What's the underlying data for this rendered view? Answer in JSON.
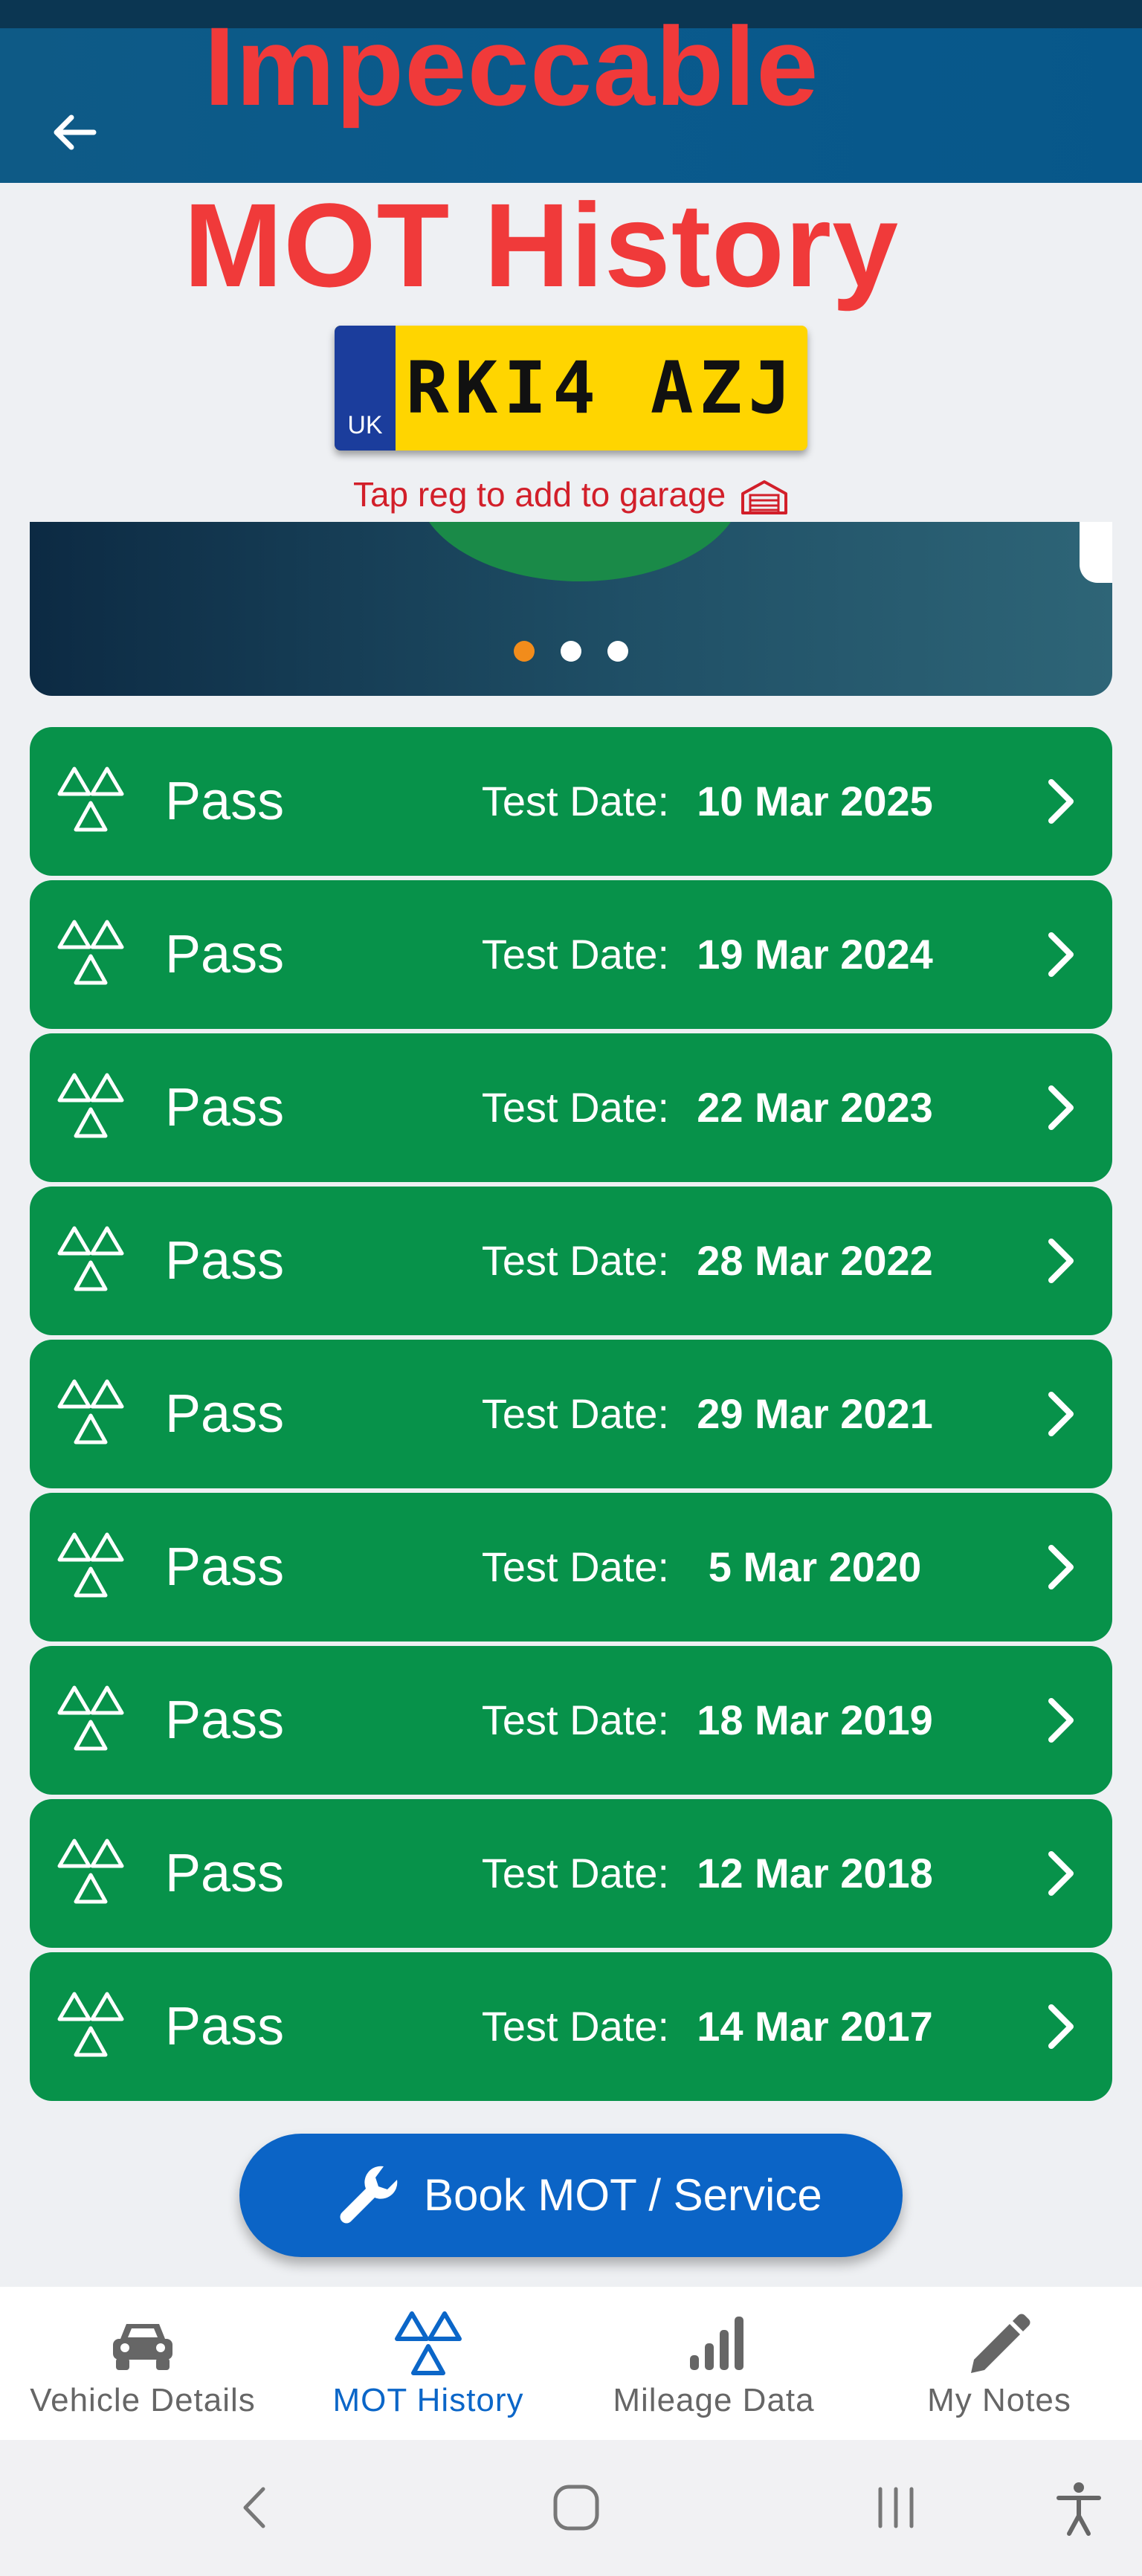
{
  "header": {
    "overlay_line1": "Impeccable",
    "overlay_line2": "MOT History",
    "back_icon": "arrow-left-icon",
    "bar_color": "#0a5a8c",
    "overlay_color": "#f03a3a"
  },
  "plate": {
    "country": "UK",
    "registration": "RKI4 AZJ"
  },
  "tap_hint": {
    "text": "Tap reg to add to garage",
    "icon": "garage-icon"
  },
  "carousel": {
    "dot_count": 3,
    "active_index": 0
  },
  "mot_tests": [
    {
      "result": "Pass",
      "label": "Test Date:",
      "date": "10 Mar 2025"
    },
    {
      "result": "Pass",
      "label": "Test Date:",
      "date": "19 Mar 2024"
    },
    {
      "result": "Pass",
      "label": "Test Date:",
      "date": "22 Mar 2023"
    },
    {
      "result": "Pass",
      "label": "Test Date:",
      "date": "28 Mar 2022"
    },
    {
      "result": "Pass",
      "label": "Test Date:",
      "date": "29 Mar 2021"
    },
    {
      "result": "Pass",
      "label": "Test Date:",
      "date": "5 Mar 2020"
    },
    {
      "result": "Pass",
      "label": "Test Date:",
      "date": "18 Mar 2019"
    },
    {
      "result": "Pass",
      "label": "Test Date:",
      "date": "12 Mar 2018"
    },
    {
      "result": "Pass",
      "label": "Test Date:",
      "date": "14 Mar 2017"
    }
  ],
  "pass_color": "#07924a",
  "book_button": {
    "label": "Book MOT / Service",
    "icon": "wrench-icon",
    "color": "#0b64c6"
  },
  "bottom_nav": {
    "active_color": "#0b66c8",
    "items": [
      {
        "label": "Vehicle Details",
        "icon": "car-icon"
      },
      {
        "label": "MOT History",
        "icon": "mot-triangle-icon"
      },
      {
        "label": "Mileage Data",
        "icon": "signal-bars-icon"
      },
      {
        "label": "My Notes",
        "icon": "pencil-icon"
      }
    ]
  },
  "system_nav": [
    "back-icon",
    "home-icon",
    "recents-icon",
    "accessibility-icon"
  ]
}
